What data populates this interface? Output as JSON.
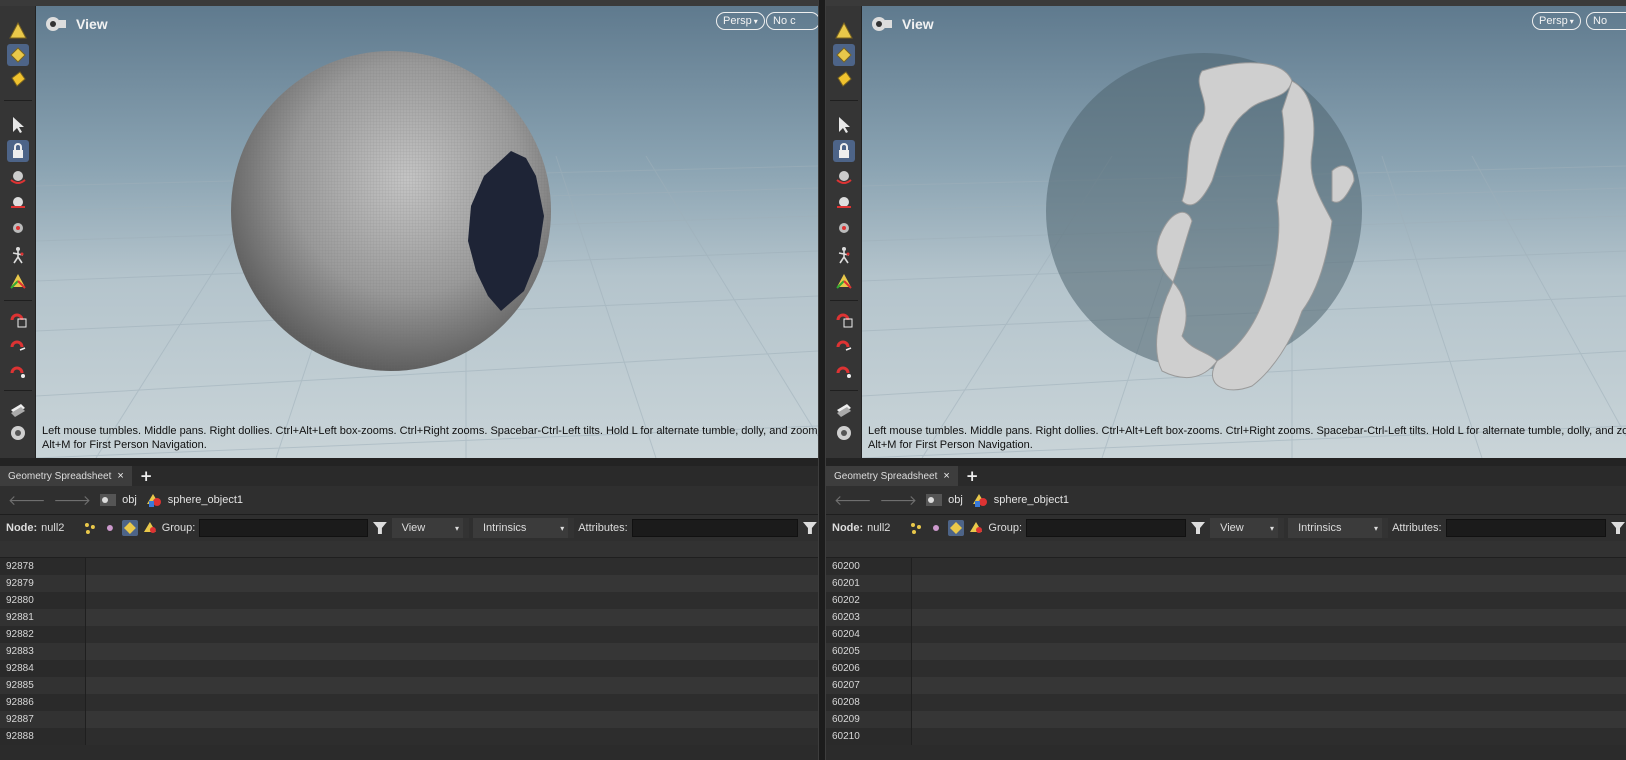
{
  "left_pane": {
    "viewport": {
      "title": "View",
      "camera_label": "Persp",
      "camera_arrow": "▾",
      "second_pill": "No c",
      "hint_line1": "Left mouse tumbles. Middle pans. Right dollies. Ctrl+Alt+Left box-zooms. Ctrl+Right zooms. Spacebar-Ctrl-Left tilts. Hold L for alternate tumble, dolly, and zoom. M o",
      "hint_line2": "Alt+M for First Person Navigation."
    },
    "tab_label": "Geometry Spreadsheet",
    "tab_close": "×",
    "tab_add": "+",
    "path": {
      "root": "obj",
      "object": "sphere_object1"
    },
    "filter": {
      "node_label": "Node:",
      "node_value": "null2",
      "group_label": "Group:",
      "view_dropdown": "View",
      "intrinsics_dropdown": "Intrinsics",
      "attributes_label": "Attributes:"
    },
    "rows": [
      "92878",
      "92879",
      "92880",
      "92881",
      "92882",
      "92883",
      "92884",
      "92885",
      "92886",
      "92887",
      "92888"
    ]
  },
  "right_pane": {
    "viewport": {
      "title": "View",
      "camera_label": "Persp",
      "camera_arrow": "▾",
      "second_pill": "No",
      "hint_line1": "Left mouse tumbles. Middle pans. Right dollies. Ctrl+Alt+Left box-zooms. Ctrl+Right zooms. Spacebar-Ctrl-Left tilts. Hold L for alternate tumble, dolly, and zoom. M",
      "hint_line2": "Alt+M for First Person Navigation."
    },
    "tab_label": "Geometry Spreadsheet",
    "tab_close": "×",
    "tab_add": "+",
    "path": {
      "root": "obj",
      "object": "sphere_object1"
    },
    "filter": {
      "node_label": "Node:",
      "node_value": "null2",
      "group_label": "Group:",
      "view_dropdown": "View",
      "intrinsics_dropdown": "Intrinsics",
      "attributes_label": "Attributes:"
    },
    "rows": [
      "60200",
      "60201",
      "60202",
      "60203",
      "60204",
      "60205",
      "60206",
      "60207",
      "60208",
      "60209",
      "60210"
    ]
  },
  "icons": [
    "view-icon",
    "select-icon",
    "lock-icon",
    "tumble-icon",
    "dolly-icon",
    "zoom-icon",
    "figure-icon",
    "transform-icon",
    "magnet-grid-icon",
    "magnet-icon",
    "snap-icon",
    "notes-icon",
    "camera-icon",
    "back-arrow-icon",
    "forward-arrow-icon",
    "obj-icon",
    "sphere-object-icon",
    "funnel-icon"
  ],
  "colors": {
    "selected_tool": "#4d6488",
    "viewport_top": "#5f7a8e",
    "viewport_bottom": "#c9d4d8"
  }
}
